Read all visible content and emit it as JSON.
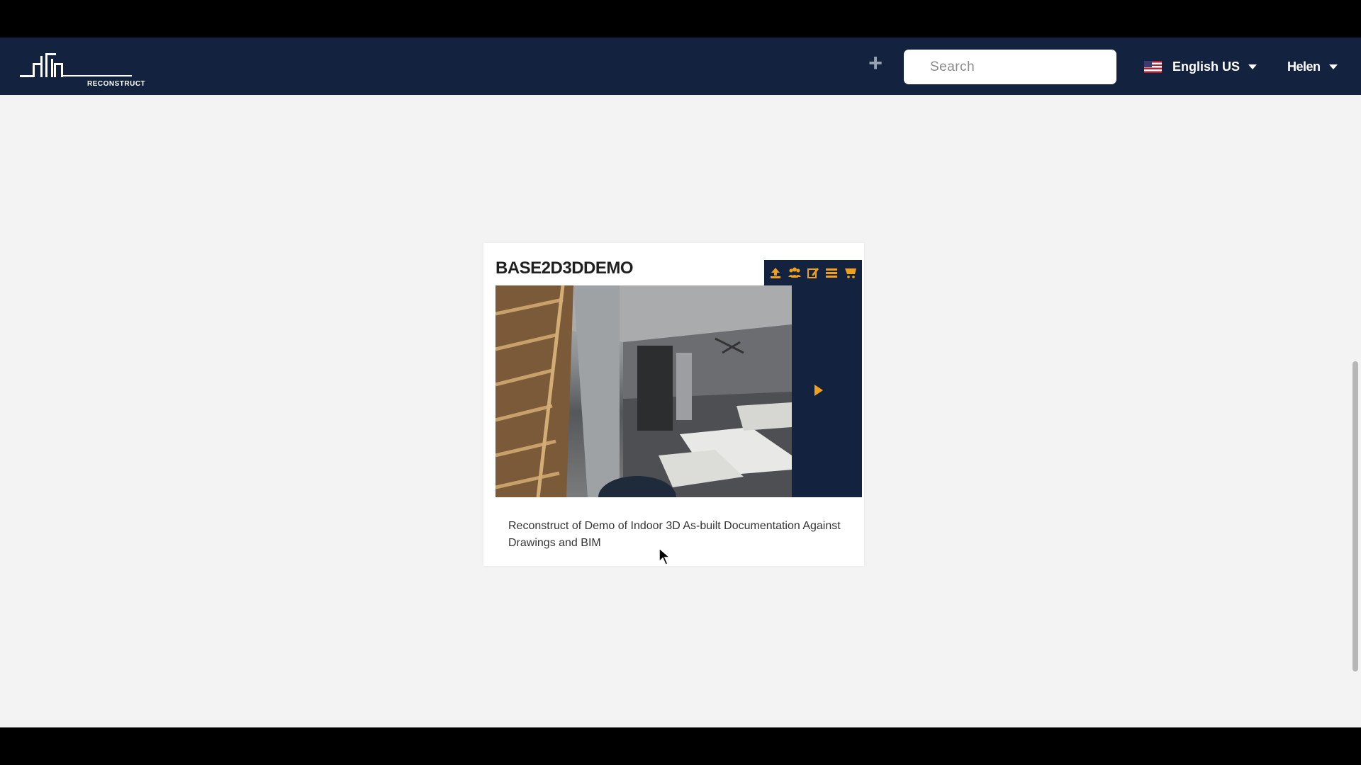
{
  "header": {
    "logo_text": "RECONSTRUCT",
    "add_icon": "plus-icon",
    "search": {
      "placeholder": "Search",
      "value": ""
    },
    "language": {
      "label": "English US",
      "flag_icon": "us-flag-icon"
    },
    "user": {
      "name": "Helen"
    }
  },
  "project_card": {
    "title": "BASE2D3DDEMO",
    "toolbar_icons": [
      "upload-icon",
      "users-icon",
      "edit-icon",
      "list-icon",
      "cart-icon"
    ],
    "play_icon": "play-icon",
    "description": "Reconstruct of Demo of Indoor 3D As-built Documentation Against Drawings and BIM"
  },
  "colors": {
    "navbar": "#13233f",
    "accent": "#f0a019",
    "page_bg": "#f3f3f3",
    "card_bg": "#ffffff"
  }
}
